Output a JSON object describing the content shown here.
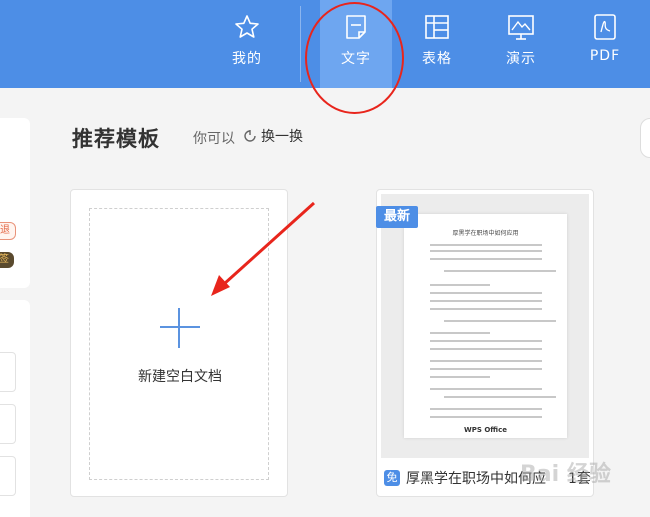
{
  "nav": {
    "items": [
      {
        "label": "我的",
        "icon": "star-icon"
      },
      {
        "label": "文字",
        "icon": "writer-doc-icon",
        "active": true
      },
      {
        "label": "表格",
        "icon": "spreadsheet-icon"
      },
      {
        "label": "演示",
        "icon": "presentation-icon"
      },
      {
        "label": "PDF",
        "icon": "pdf-icon"
      }
    ]
  },
  "left_panel": {
    "badge_a": "退",
    "badge_b": "签"
  },
  "section": {
    "title": "推荐模板",
    "hint": "你可以",
    "refresh_label": "换一换"
  },
  "blank_card": {
    "label": "新建空白文档"
  },
  "template_card": {
    "badge": "最新",
    "member_icon": "免",
    "name": "厚黑学在职场中如何应",
    "count": "1套",
    "doc_title": "厚黑学在职场中如何应用",
    "doc_logo": "WPS Office"
  },
  "watermark": "Bai 经验",
  "colors": {
    "topbar": "#4d8ee6",
    "active_tab": "#6ea6f0",
    "annotation_red": "#e8251c",
    "accent": "#5b93e0"
  }
}
